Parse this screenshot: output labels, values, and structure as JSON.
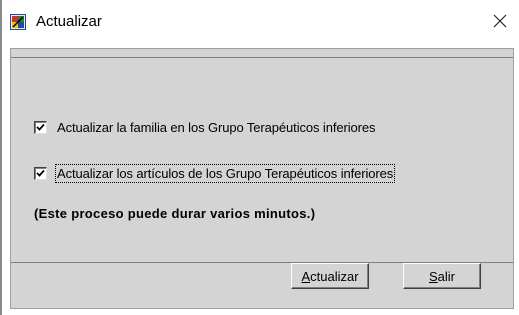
{
  "window": {
    "title": "Actualizar",
    "close_glyph": "✕",
    "app_icon": "dialog-app-icon"
  },
  "options": [
    {
      "label": "Actualizar la familia en los Grupo Terapéuticos inferiores",
      "checked": true
    },
    {
      "label": "Actualizar los artículos de los Grupo Terapéuticos inferiores",
      "checked": true
    }
  ],
  "note": "(Este proceso puede durar varios minutos.)",
  "buttons": {
    "update": {
      "mnemonic": "A",
      "rest": "ctualizar"
    },
    "exit": {
      "mnemonic": "S",
      "rest": "alir"
    }
  },
  "colors": {
    "panel": "#d4d4d4",
    "titlebar": "#ffffff"
  }
}
